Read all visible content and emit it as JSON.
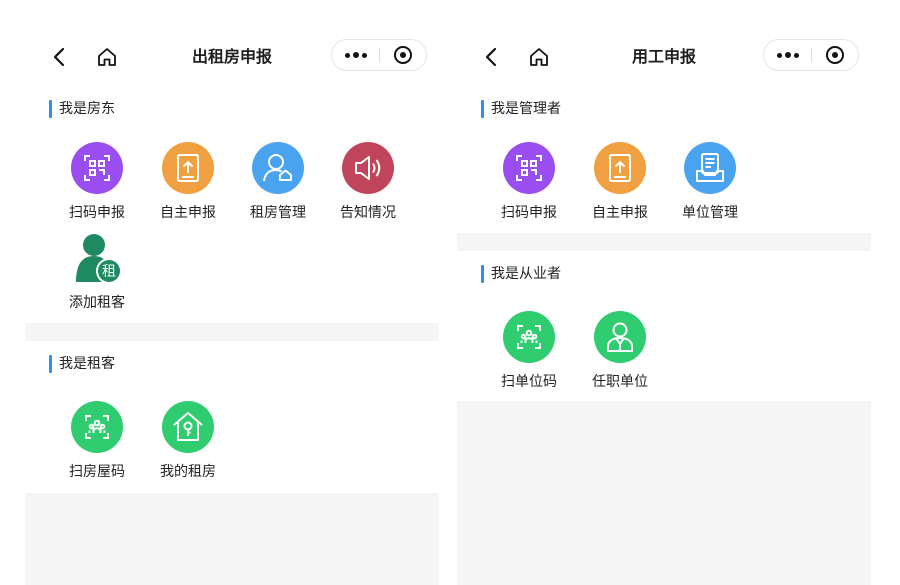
{
  "left": {
    "title": "出租房申报",
    "landlord": {
      "heading": "我是房东",
      "items": [
        {
          "label": "扫码申报",
          "icon": "qr-scan-icon",
          "color": "#9a4df0"
        },
        {
          "label": "自主申报",
          "icon": "upload-document-icon",
          "color": "#f0a040"
        },
        {
          "label": "租房管理",
          "icon": "person-house-icon",
          "color": "#4aa3ee"
        },
        {
          "label": "告知情况",
          "icon": "speaker-icon",
          "color": "#c0445a"
        },
        {
          "label": "添加租客",
          "icon": "add-tenant-icon",
          "badge": "租",
          "color": "#1f8a62"
        }
      ]
    },
    "tenant": {
      "heading": "我是租客",
      "items": [
        {
          "label": "扫房屋码",
          "icon": "scan-people-icon",
          "color": "#2fcc70"
        },
        {
          "label": "我的租房",
          "icon": "house-key-icon",
          "color": "#2fcc70"
        }
      ]
    }
  },
  "right": {
    "title": "用工申报",
    "manager": {
      "heading": "我是管理者",
      "items": [
        {
          "label": "扫码申报",
          "icon": "qr-scan-icon",
          "color": "#9a4df0"
        },
        {
          "label": "自主申报",
          "icon": "upload-document-icon",
          "color": "#f0a040"
        },
        {
          "label": "单位管理",
          "icon": "document-tray-icon",
          "color": "#4aa3ee"
        }
      ]
    },
    "worker": {
      "heading": "我是从业者",
      "items": [
        {
          "label": "扫单位码",
          "icon": "scan-people-icon",
          "color": "#2fcc70"
        },
        {
          "label": "任职单位",
          "icon": "employee-icon",
          "color": "#2fcc70"
        }
      ]
    }
  }
}
